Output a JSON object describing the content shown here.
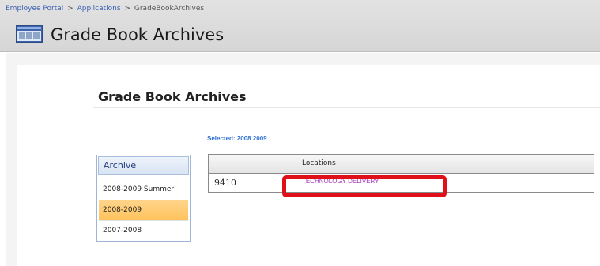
{
  "header": {
    "breadcrumb": [
      {
        "label": "Employee Portal"
      },
      {
        "label": "Applications"
      },
      {
        "label": "GradeBookArchives"
      }
    ],
    "separator": ">",
    "title": "Grade Book Archives",
    "icon": "application-window-icon"
  },
  "main": {
    "section_title": "Grade Book Archives",
    "selected_label": "Selected: 2008 2009"
  },
  "archive": {
    "header": "Archive",
    "items": [
      {
        "label": "2008-2009 Summer",
        "selected": false
      },
      {
        "label": "2008-2009",
        "selected": true
      },
      {
        "label": "2007-2008",
        "selected": false
      }
    ]
  },
  "locations": {
    "columns": [
      "",
      "Locations"
    ],
    "rows": [
      {
        "code": "9410",
        "name": "TECHNOLOGY DELIVERY"
      }
    ]
  },
  "colors": {
    "selected_item": "#ffc35c",
    "location_link": "#a034b8",
    "highlight": "#e0101a",
    "selected_text": "#2b6fd6"
  }
}
